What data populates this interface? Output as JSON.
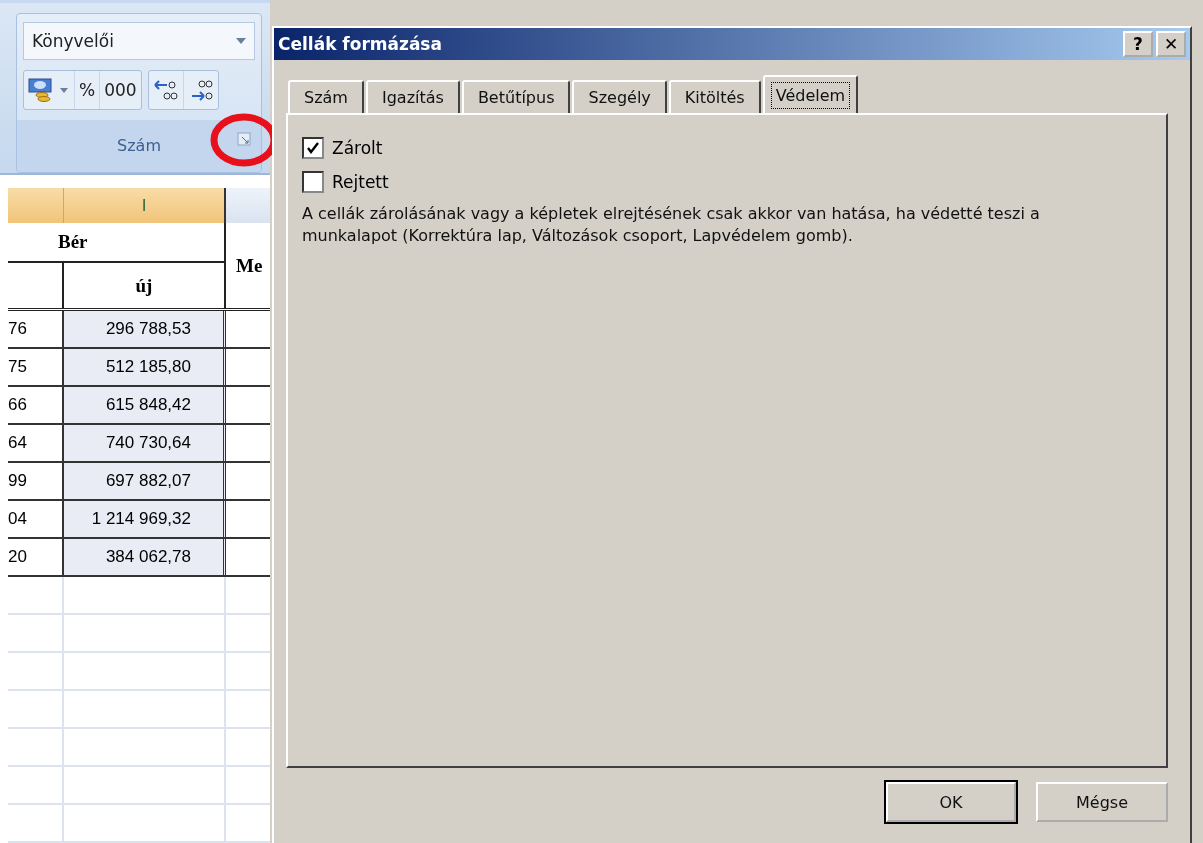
{
  "ribbon": {
    "number_format": {
      "value": "Könyvelői"
    },
    "buttons": [
      {
        "kind": "currency"
      },
      {
        "kind": "text",
        "label": "%"
      },
      {
        "kind": "text",
        "label": "000"
      },
      {
        "kind": "decimal_more"
      },
      {
        "kind": "decimal_less"
      }
    ],
    "group_label": "Szám"
  },
  "sheet": {
    "columns": [
      {
        "selected": true
      },
      {
        "label": "I",
        "selected": true
      },
      {
        "selected": false
      }
    ],
    "header": {
      "group": "Bér",
      "sub": "új",
      "column_3": "Me"
    },
    "rows": [
      {
        "column_1": "76",
        "new": "296 788,53"
      },
      {
        "column_1": "75",
        "new": "512 185,80"
      },
      {
        "column_1": "66",
        "new": "615 848,42"
      },
      {
        "column_1": "64",
        "new": "740 730,64"
      },
      {
        "column_1": "99",
        "new": "697 882,07"
      },
      {
        "column_1": "04",
        "new": "1 214 969,32"
      },
      {
        "column_1": "20",
        "new": "384 062,78"
      }
    ]
  },
  "dialog": {
    "title": "Cellák formázása",
    "help": "?",
    "close": "✕",
    "tabs": [
      {
        "label": "Szám",
        "selected": false
      },
      {
        "label": "Igazítás",
        "selected": false
      },
      {
        "label": "Betűtípus",
        "selected": false
      },
      {
        "label": "Szegély",
        "selected": false
      },
      {
        "label": "Kitöltés",
        "selected": false
      },
      {
        "label": "Védelem",
        "selected": true
      }
    ],
    "options": [
      {
        "label": "Zárolt",
        "checked": true
      },
      {
        "label": "Rejtett",
        "checked": false
      }
    ],
    "note": "A cellák zárolásának vagy a képletek elrejtésének csak akkor van hatása, ha védetté teszi a munkalapot (Korrektúra lap, Változások csoport, Lapvédelem gomb).",
    "buttons": [
      {
        "label": "OK",
        "default": true
      },
      {
        "label": "Mégse",
        "default": false
      }
    ]
  }
}
